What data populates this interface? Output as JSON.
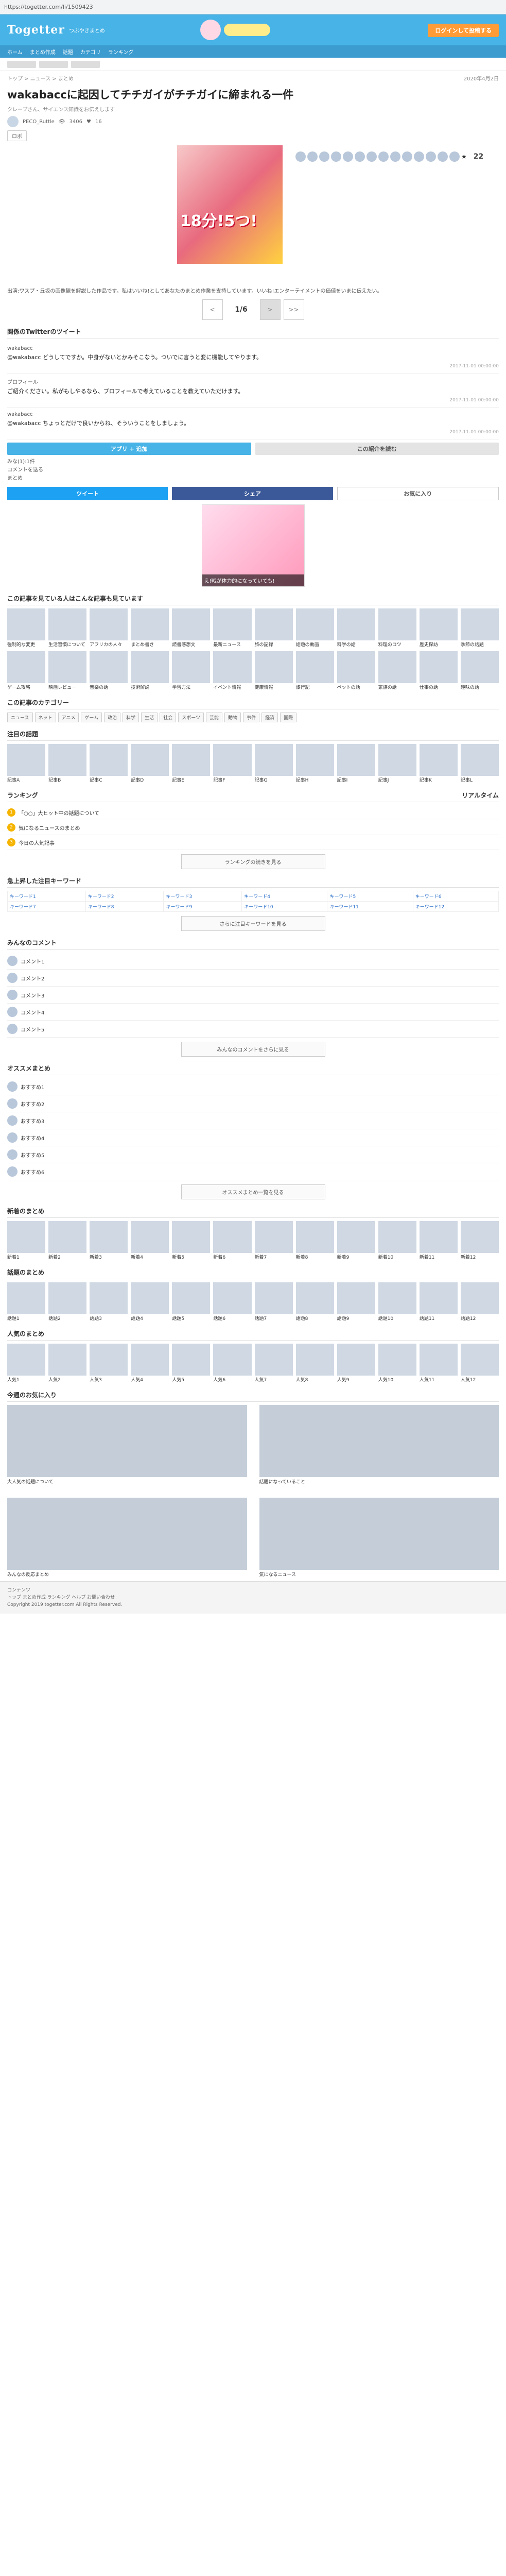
{
  "browser": {
    "url": "https://togetter.com/li/1509423"
  },
  "header": {
    "logo": "Togetter",
    "tagline": "つぶやきまとめ",
    "signup": "ログインして投稿する",
    "nav": [
      "ホーム",
      "まとめ作成",
      "話題",
      "カテゴリ",
      "ランキング"
    ]
  },
  "breadcrumb": {
    "path": "トップ > ニュース > まとめ",
    "date": "2020年4月2日"
  },
  "title": "wakabaccに起因してチチガイがチチガイに締まれる一件",
  "meta": "クレープさん、サイエンス知識をお伝えします",
  "user": {
    "name": "PECO_Ruttle",
    "views": "3406",
    "likes": "16"
  },
  "tag": "ロボ",
  "hero": {
    "banner": "18分!5つ!",
    "count": "22"
  },
  "description": "出演:ワスプ・丘坂の画像観を解説した作品です。私はいいね!としてあなたのまとめ作業を支持しています。いいね!エンターテイメントの価値をいまに伝えたい。",
  "pager": {
    "prev": "<",
    "current": "1/6",
    "next": ">",
    "last": ">>"
  },
  "section1": "関係のTwitterのツイート",
  "tweets": [
    {
      "name": "wakabacc",
      "body": "@wakabacc どうしてですか。中身がないとかみそこなう。ついでに言うと変に機能してやります。",
      "date": "2017-11-01 00:00:00"
    },
    {
      "name": "プロフィール",
      "body": "ご紹介ください。私がもしやるなら、プロフィールで考えていることを教えていただけます。",
      "date": "2017-11-01 00:00:00"
    },
    {
      "name": "wakabacc",
      "body": "@wakabacc ちょっとだけで良いからね、そういうことをしましょう。",
      "date": "2017-11-01 00:00:00"
    }
  ],
  "follow": {
    "left": "アプリ + 追加",
    "right": "この紹介を読む"
  },
  "engagement": {
    "line1": "みな(1):1件",
    "line2": "コメントを送る",
    "line3": "まとめ"
  },
  "share": {
    "twitter": "ツイート",
    "facebook": "シェア",
    "hatena": "お気に入り"
  },
  "ad": {
    "caption": "え!戦が体力的になっていても!"
  },
  "related_title": "この記事を見ている人はこんな記事も見ています",
  "related": [
    "強制的な変更",
    "生活習慣について",
    "アフリカの人々",
    "まとめ書き",
    "読書感想文",
    "最新ニュース",
    "旅の記録",
    "話題の動画",
    "科学の話",
    "料理のコツ",
    "歴史探訪",
    "季節の話題",
    "ゲーム攻略",
    "映画レビュー",
    "音楽の話",
    "技術解説",
    "学習方法",
    "イベント情報",
    "健康情報",
    "旅行記",
    "ペットの話",
    "家族の話",
    "仕事の話",
    "趣味の話"
  ],
  "category_title": "この記事のカテゴリー",
  "categories": [
    "ニュース",
    "ネット",
    "アニメ",
    "ゲーム",
    "政治",
    "科学",
    "生活",
    "社会",
    "スポーツ",
    "芸能",
    "動物",
    "事件",
    "経済",
    "国際"
  ],
  "popular_title": "注目の話題",
  "popular": [
    "記事A",
    "記事B",
    "記事C",
    "記事D",
    "記事E",
    "記事F",
    "記事G",
    "記事H",
    "記事I",
    "記事J",
    "記事K",
    "記事L"
  ],
  "ranking": {
    "title": "ランキング",
    "subtitle": "リアルタイム",
    "items": [
      "「○○」大ヒット中の話題について",
      "気になるニュースのまとめ",
      "今日の人気記事"
    ],
    "more": "ランキングの続きを見る"
  },
  "keywords_title": "急上昇した注目キーワード",
  "keywords": [
    [
      "キーワード1",
      "キーワード2",
      "キーワード3",
      "キーワード4",
      "キーワード5",
      "キーワード6"
    ],
    [
      "キーワード7",
      "キーワード8",
      "キーワード9",
      "キーワード10",
      "キーワード11",
      "キーワード12"
    ]
  ],
  "keywords_more": "さらに注目キーワードを見る",
  "comments": {
    "title": "みんなのコメント",
    "items": [
      "コメント1",
      "コメント2",
      "コメント3",
      "コメント4",
      "コメント5"
    ],
    "more": "みんなのコメントをさらに見る"
  },
  "recommend": {
    "title": "オススメまとめ",
    "items": [
      "おすすめ1",
      "おすすめ2",
      "おすすめ3",
      "おすすめ4",
      "おすすめ5",
      "おすすめ6"
    ],
    "more": "オススメまとめ一覧を見る"
  },
  "new_title": "新着のまとめ",
  "new_items": [
    "新着1",
    "新着2",
    "新着3",
    "新着4",
    "新着5",
    "新着6",
    "新着7",
    "新着8",
    "新着9",
    "新着10",
    "新着11",
    "新着12"
  ],
  "hot_title": "話題のまとめ",
  "hot_items": [
    "話題1",
    "話題2",
    "話題3",
    "話題4",
    "話題5",
    "話題6",
    "話題7",
    "話題8",
    "話題9",
    "話題10",
    "話題11",
    "話題12"
  ],
  "trend_title": "人気のまとめ",
  "trend_items": [
    "人気1",
    "人気2",
    "人気3",
    "人気4",
    "人気5",
    "人気6",
    "人気7",
    "人気8",
    "人気9",
    "人気10",
    "人気11",
    "人気12"
  ],
  "featured_title": "今週のお気に入り",
  "featured": [
    "大人気の話題について",
    "話題になっていること",
    "みんなの反応まとめ",
    "気になるニュース"
  ],
  "footer": {
    "line1": "コンテンツ",
    "line2": "トップ まとめ作成 ランキング ヘルプ お問い合わせ",
    "copyright": "Copyright 2019 togetter.com All Rights Reserved."
  }
}
